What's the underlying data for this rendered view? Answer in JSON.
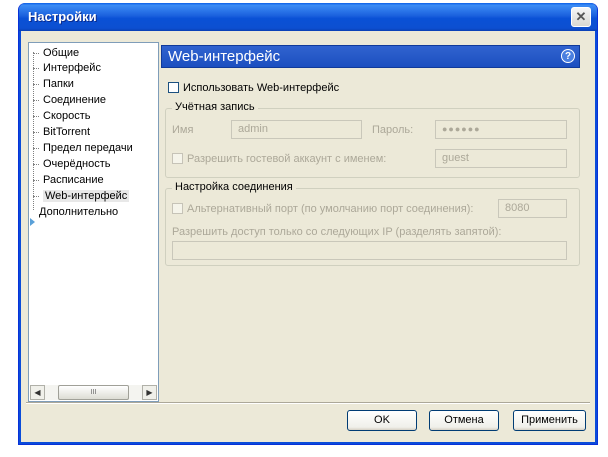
{
  "window": {
    "title": "Настройки"
  },
  "nav": {
    "items": [
      {
        "label": "Общие"
      },
      {
        "label": "Интерфейс"
      },
      {
        "label": "Папки"
      },
      {
        "label": "Соединение"
      },
      {
        "label": "Скорость"
      },
      {
        "label": "BitTorrent"
      },
      {
        "label": "Предел передачи"
      },
      {
        "label": "Очерёдность"
      },
      {
        "label": "Расписание"
      },
      {
        "label": "Web-интерфейс"
      },
      {
        "label": "Дополнительно"
      }
    ],
    "selected": "Web-интерфейс",
    "scroll_thumb": "III"
  },
  "panel": {
    "title": "Web-интерфейс",
    "help": "?",
    "use_web_ui": "Использовать Web-интерфейс",
    "account": {
      "title": "Учётная запись",
      "user_label": "Имя",
      "user_value": "admin",
      "password_label": "Пароль:",
      "password_value": "●●●●●●",
      "guest_label": "Разрешить гостевой аккаунт с именем:",
      "guest_value": "guest"
    },
    "connection": {
      "title": "Настройка соединения",
      "alt_port_label": "Альтернативный порт (по умолчанию порт соединения):",
      "alt_port_value": "8080",
      "ip_label": "Разрешить доступ только со следующих IP (разделять запятой):",
      "ip_value": ""
    }
  },
  "buttons": {
    "ok": "OK",
    "cancel": "Отмена",
    "apply": "Применить"
  },
  "icons": {
    "close": "close-icon",
    "help": "help-icon",
    "expand": "expand-arrow-icon"
  }
}
